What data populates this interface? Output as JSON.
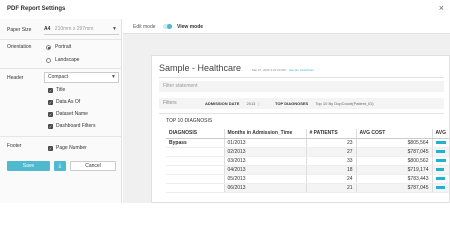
{
  "window": {
    "title": "PDF Report Settings",
    "close_glyph": "×"
  },
  "settings": {
    "paper_size": {
      "label": "Paper Size",
      "value": "A4",
      "dimensions": "210mm x 297mm"
    },
    "orientation": {
      "label": "Orientation",
      "options": [
        {
          "label": "Portrait",
          "selected": true
        },
        {
          "label": "Landscape",
          "selected": false
        }
      ]
    },
    "header": {
      "label": "Header",
      "value": "Compact",
      "options": [
        {
          "label": "Title",
          "checked": true
        },
        {
          "label": "Data As Of",
          "checked": true
        },
        {
          "label": "Dataset Name",
          "checked": true
        },
        {
          "label": "Dashboard Filters",
          "checked": true
        }
      ]
    },
    "footer": {
      "label": "Footer",
      "options": [
        {
          "label": "Page Number",
          "checked": true
        }
      ]
    }
  },
  "actions": {
    "save": "Save",
    "download_glyph": "⤓",
    "cancel": "Cancel"
  },
  "mode": {
    "edit_label": "Edit mode",
    "view_label": "View mode",
    "edit_enabled": false
  },
  "report": {
    "title": "Sample - Healthcare",
    "meta": "Mar 27, 2020 4:22:29 PM",
    "dataset": "Sample Healthcare",
    "filter_statement": "Filter statement",
    "filters_label": "Filters",
    "filter_items": [
      {
        "name": "ADMISSION DATE",
        "value": "2013"
      },
      {
        "name": "TOP DIAGNOSES",
        "value": "Top 10 By DupCount(Patient_ID)"
      }
    ],
    "table_heading": "TOP 10 DIAGNOSIS",
    "columns": [
      "DIAGNOSIS",
      "Months in Admission_Time",
      "# PATIENTS",
      "AVG COST",
      "AVG"
    ],
    "rows": [
      {
        "diagnosis": "Bypass",
        "month": "01/2013",
        "patients": "23",
        "avg_cost": "$805,564",
        "avg": 0.7
      },
      {
        "diagnosis": "",
        "month": "02/2013",
        "patients": "27",
        "avg_cost": "$787,045",
        "avg": 0.65
      },
      {
        "diagnosis": "",
        "month": "03/2013",
        "patients": "33",
        "avg_cost": "$800,562",
        "avg": 0.7
      },
      {
        "diagnosis": "",
        "month": "04/2013",
        "patients": "18",
        "avg_cost": "$719,174",
        "avg": 0.6
      },
      {
        "diagnosis": "",
        "month": "05/2013",
        "patients": "24",
        "avg_cost": "$783,443",
        "avg": 0.65
      },
      {
        "diagnosis": "",
        "month": "06/2013",
        "patients": "21",
        "avg_cost": "$787,045",
        "avg": 0.65
      }
    ],
    "accent_color": "#1fb3d2"
  }
}
